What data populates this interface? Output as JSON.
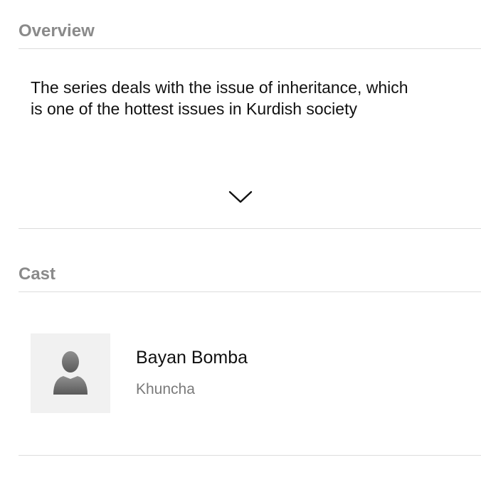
{
  "overview": {
    "header": "Overview",
    "text": "The series deals with the issue of inheritance, which is one of the hottest issues in Kurdish society",
    "expand_icon": "chevron-down-icon"
  },
  "cast": {
    "header": "Cast",
    "members": [
      {
        "name": "Bayan Bomba",
        "character": "Khuncha",
        "avatar_icon": "person-placeholder-icon"
      }
    ]
  },
  "colors": {
    "section_header": "#8a8a8a",
    "divider": "#dcdcdc",
    "avatar_bg": "#f1f1f1",
    "secondary_text": "#7a7a7a"
  }
}
